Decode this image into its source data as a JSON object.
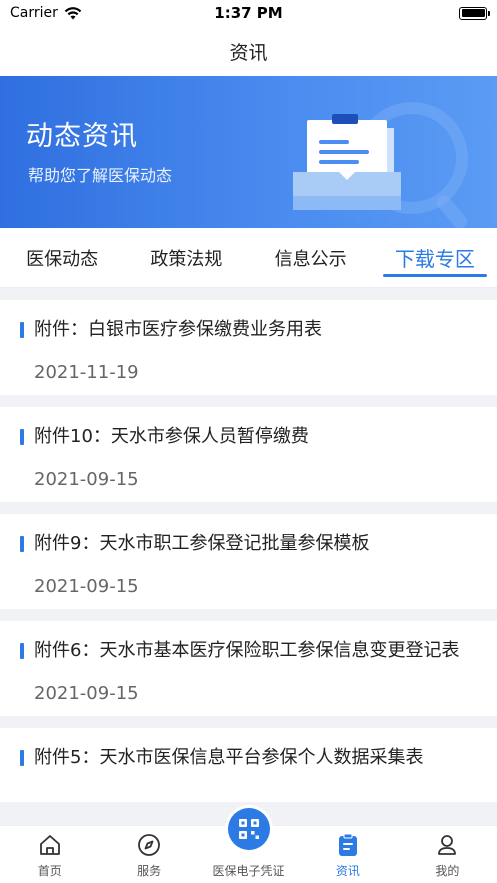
{
  "status_bar": {
    "carrier": "Carrier",
    "time": "1:37 PM"
  },
  "nav": {
    "title": "资讯"
  },
  "banner": {
    "title": "动态资讯",
    "subtitle": "帮助您了解医保动态"
  },
  "tabs": [
    {
      "label": "医保动态"
    },
    {
      "label": "政策法规"
    },
    {
      "label": "信息公示"
    },
    {
      "label": "下载专区"
    }
  ],
  "active_tab": "下载专区",
  "items": [
    {
      "title": "附件：白银市医疗参保缴费业务用表",
      "date": "2021-11-19"
    },
    {
      "title": "附件10：天水市参保人员暂停缴费",
      "date": "2021-09-15"
    },
    {
      "title": "附件9：天水市职工参保登记批量参保模板",
      "date": "2021-09-15"
    },
    {
      "title": "附件6：天水市基本医疗保险职工参保信息变更登记表",
      "date": "2021-09-15"
    },
    {
      "title": "附件5：天水市医保信息平台参保个人数据采集表",
      "date": ""
    }
  ],
  "tabbar": [
    {
      "label": "首页",
      "icon": "home-icon"
    },
    {
      "label": "服务",
      "icon": "compass-icon"
    },
    {
      "label": "医保电子凭证",
      "icon": "qrcode-icon"
    },
    {
      "label": "资讯",
      "icon": "news-icon"
    },
    {
      "label": "我的",
      "icon": "user-icon"
    }
  ],
  "colors": {
    "accent": "#2c7be5",
    "banner_start": "#2f6fe0",
    "banner_end": "#5a9bf4"
  }
}
